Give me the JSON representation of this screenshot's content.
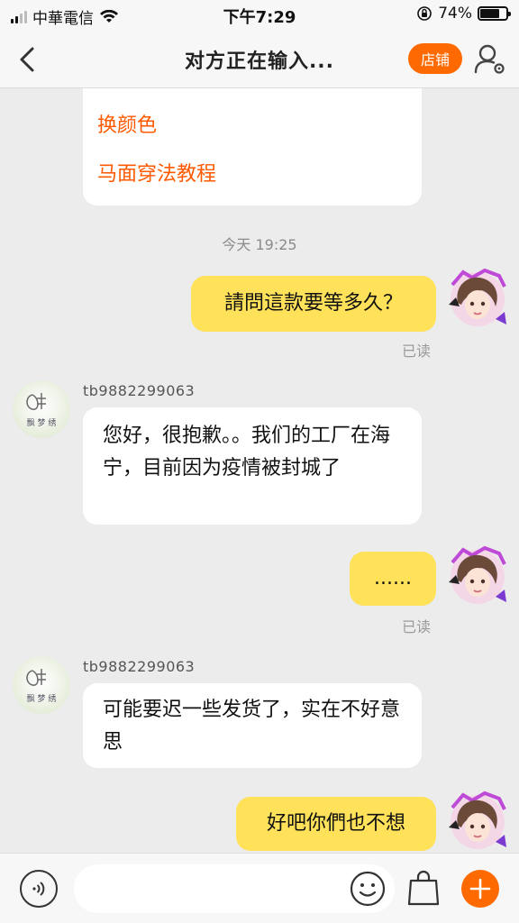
{
  "status_bar": {
    "carrier": "中華電信",
    "time": "下午7:29",
    "battery": "74%"
  },
  "nav": {
    "title": "对方正在输入...",
    "shop_button": "店铺"
  },
  "chat": {
    "card_links": [
      "换颜色",
      "马面穿法教程"
    ],
    "timestamp": "今天 19:25",
    "messages": [
      {
        "from": "me",
        "text": "請問這款要等多久？",
        "status": "已读"
      },
      {
        "from": "shop",
        "sender": "tb9882299063",
        "text": "您好，很抱歉。。我们的工厂在海宁，目前因为疫情被封城了"
      },
      {
        "from": "me",
        "text": "......",
        "status": "已读"
      },
      {
        "from": "shop",
        "sender": "tb9882299063",
        "text": "可能要迟一些发货了，实在不好意思"
      },
      {
        "from": "me",
        "text": "好吧你們也不想"
      }
    ]
  },
  "input": {
    "placeholder": ""
  },
  "colors": {
    "accent": "#ff6a00",
    "my_bubble": "#ffe15a",
    "link": "#ff5a00"
  }
}
